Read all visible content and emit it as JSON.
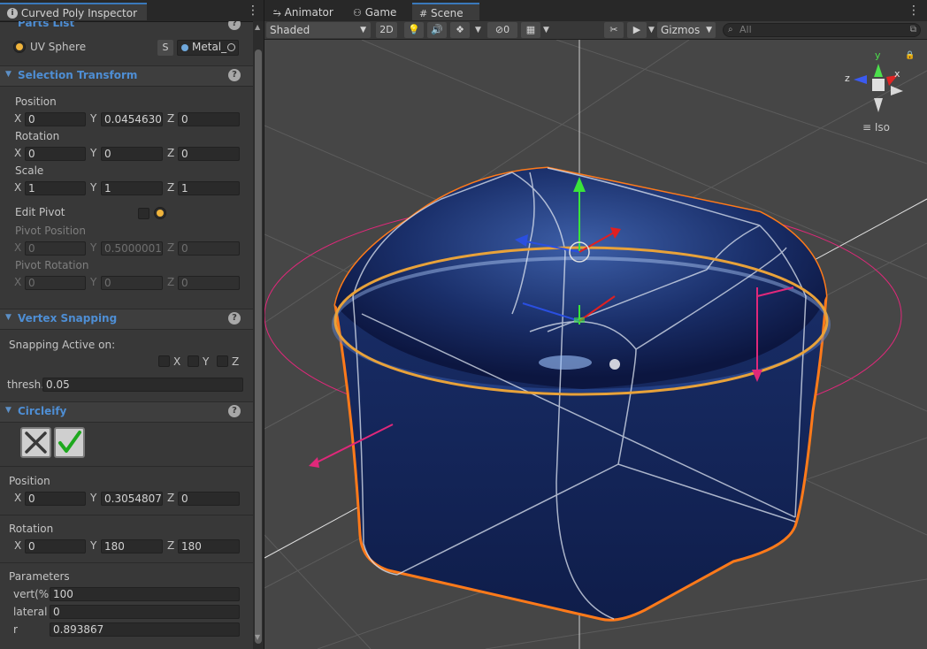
{
  "inspector": {
    "tab_title": "Curved Poly Inspector",
    "parts_list": {
      "title": "Parts List",
      "item": "UV Sphere",
      "s_button": "S",
      "material": "Metal_"
    },
    "selection_transform": {
      "title": "Selection Transform",
      "position_label": "Position",
      "position": {
        "x": "0",
        "y": "0.0454630",
        "z": "0"
      },
      "rotation_label": "Rotation",
      "rotation": {
        "x": "0",
        "y": "0",
        "z": "0"
      },
      "scale_label": "Scale",
      "scale": {
        "x": "1",
        "y": "1",
        "z": "1"
      },
      "edit_pivot_label": "Edit Pivot",
      "pivot_position_label": "Pivot Position",
      "pivot_position": {
        "x": "0",
        "y": "0.5000001",
        "z": "0"
      },
      "pivot_rotation_label": "Pivot Rotation",
      "pivot_rotation": {
        "x": "0",
        "y": "0",
        "z": "0"
      }
    },
    "vertex_snapping": {
      "title": "Vertex Snapping",
      "active_label": "Snapping Active on:",
      "x_label": "X",
      "y_label": "Y",
      "z_label": "Z",
      "thresh_label": "thresh.",
      "thresh_value": "0.05"
    },
    "circleify": {
      "title": "Circleify",
      "position_label": "Position",
      "position": {
        "x": "0",
        "y": "0.3054807",
        "z": "0"
      },
      "rotation_label": "Rotation",
      "rotation": {
        "x": "0",
        "y": "180",
        "z": "180"
      },
      "parameters_label": "Parameters",
      "vert_label": "vert(%)",
      "vert_value": "100",
      "lateral_label": "lateral",
      "lateral_value": "0",
      "r_label": "r",
      "r_value": "0.893867"
    },
    "axis_labels": {
      "x": "X",
      "y": "Y",
      "z": "Z"
    },
    "help_glyph": "?"
  },
  "scene": {
    "tabs": [
      {
        "label": "Animator",
        "icon": "animator-icon"
      },
      {
        "label": "Game",
        "icon": "gamepad-icon"
      },
      {
        "label": "Scene",
        "icon": "grid-icon",
        "active": true
      }
    ],
    "toolbar": {
      "shading": "Shaded",
      "mode_2d": "2D",
      "hidden_count": "0",
      "gizmos": "Gizmos",
      "search_placeholder": "All"
    },
    "gizmo": {
      "view_label": "Iso",
      "x": "x",
      "y": "y",
      "z": "z"
    }
  },
  "colors": {
    "accent_blue": "#4e8ed4",
    "selection_orange": "#ff7a1a",
    "circle_gold": "#e8a23a",
    "magenta": "#e0287a"
  }
}
